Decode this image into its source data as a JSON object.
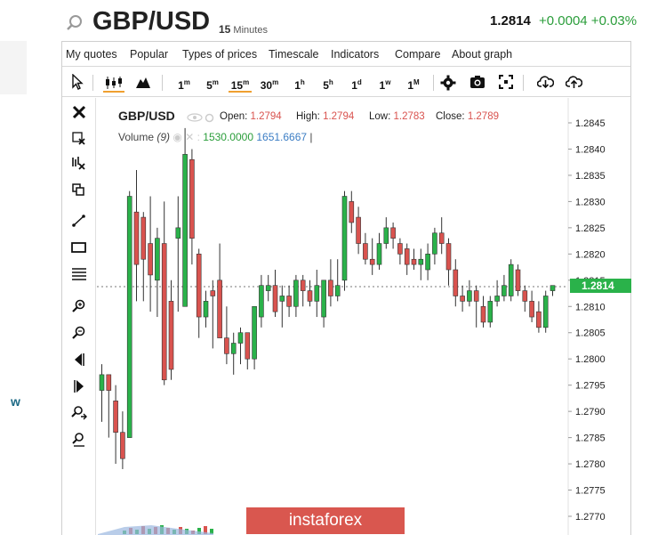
{
  "header": {
    "symbol": "GBP/USD",
    "interval_number": "15",
    "interval_unit": "Minutes",
    "price": "1.2814",
    "change": "+0.0004 +0.03%"
  },
  "menu": [
    "My quotes",
    "Popular",
    "Types of prices",
    "Timescale",
    "Indicators",
    "Compare",
    "About graph"
  ],
  "timeframes": [
    {
      "base": "1",
      "sup": "m",
      "active": false
    },
    {
      "base": "5",
      "sup": "m",
      "active": false
    },
    {
      "base": "15",
      "sup": "m",
      "active": true
    },
    {
      "base": "30",
      "sup": "m",
      "active": false
    },
    {
      "base": "1",
      "sup": "h",
      "active": false
    },
    {
      "base": "5",
      "sup": "h",
      "active": false
    },
    {
      "base": "1",
      "sup": "d",
      "active": false
    },
    {
      "base": "1",
      "sup": "w",
      "active": false
    },
    {
      "base": "1",
      "sup": "M",
      "active": false
    }
  ],
  "toolbar_icons": [
    "cursor-icon",
    "candlestick-icon",
    "area-chart-icon",
    "gear-icon",
    "camera-icon",
    "fullscreen-icon",
    "download-icon",
    "upload-icon"
  ],
  "left_tool_icons": [
    "close-icon",
    "remove-drawings-icon",
    "remove-indicators-icon",
    "copy-icon",
    "trendline-icon",
    "rectangle-icon",
    "fibonacci-icon",
    "zoom-in-icon",
    "zoom-out-icon",
    "scroll-left-icon",
    "scroll-right-icon",
    "zoom-reset-icon",
    "zoom-fit-icon"
  ],
  "legend": {
    "symbol": "GBP/USD",
    "open_label": "Open:",
    "open": "1.2794",
    "high_label": "High:",
    "high": "1.2794",
    "low_label": "Low:",
    "low": "1.2783",
    "close_label": "Close:",
    "close": "1.2789",
    "volume_label": "Volume",
    "volume_period": "(9)",
    "volume_value_1": "1530.0000",
    "volume_value_2": "1651.6667",
    "volume_cursor": "|"
  },
  "price_tag": "1.2814",
  "watermark": "instaforex",
  "side_logo": "w",
  "colors": {
    "up": "#2ab24a",
    "down": "#d9534f",
    "accent": "#f0a030",
    "change": "#2a9d3a"
  },
  "chart_data": {
    "type": "candlestick",
    "title": "GBP/USD",
    "ylim": [
      1.2768,
      1.2852
    ],
    "y_ticks": [
      "1.2845",
      "1.2840",
      "1.2835",
      "1.2830",
      "1.2825",
      "1.2820",
      "1.2815",
      "1.2810",
      "1.2805",
      "1.2800",
      "1.2795",
      "1.2790",
      "1.2785",
      "1.2780",
      "1.2775",
      "1.2770"
    ],
    "last_price": 1.2814,
    "candles": [
      {
        "o": 1.2794,
        "h": 1.2799,
        "l": 1.2788,
        "c": 1.2797
      },
      {
        "o": 1.2797,
        "h": 1.2797,
        "l": 1.2785,
        "c": 1.2794
      },
      {
        "o": 1.2792,
        "h": 1.2795,
        "l": 1.278,
        "c": 1.2786
      },
      {
        "o": 1.2786,
        "h": 1.279,
        "l": 1.2779,
        "c": 1.2781
      },
      {
        "o": 1.2785,
        "h": 1.2832,
        "l": 1.2785,
        "c": 1.2831
      },
      {
        "o": 1.2828,
        "h": 1.2836,
        "l": 1.2811,
        "c": 1.2818
      },
      {
        "o": 1.2827,
        "h": 1.2828,
        "l": 1.2811,
        "c": 1.2819
      },
      {
        "o": 1.2822,
        "h": 1.2831,
        "l": 1.2809,
        "c": 1.2816
      },
      {
        "o": 1.2815,
        "h": 1.2825,
        "l": 1.2808,
        "c": 1.2823
      },
      {
        "o": 1.2822,
        "h": 1.283,
        "l": 1.2795,
        "c": 1.2796
      },
      {
        "o": 1.2811,
        "h": 1.2815,
        "l": 1.2796,
        "c": 1.2798
      },
      {
        "o": 1.2823,
        "h": 1.2831,
        "l": 1.2809,
        "c": 1.2825
      },
      {
        "o": 1.281,
        "h": 1.2844,
        "l": 1.281,
        "c": 1.2839
      },
      {
        "o": 1.2838,
        "h": 1.284,
        "l": 1.2818,
        "c": 1.2823
      },
      {
        "o": 1.282,
        "h": 1.2821,
        "l": 1.2804,
        "c": 1.2808
      },
      {
        "o": 1.2808,
        "h": 1.2813,
        "l": 1.2806,
        "c": 1.2811
      },
      {
        "o": 1.2813,
        "h": 1.2815,
        "l": 1.2802,
        "c": 1.2812
      },
      {
        "o": 1.2815,
        "h": 1.2822,
        "l": 1.2805,
        "c": 1.2804
      },
      {
        "o": 1.2804,
        "h": 1.281,
        "l": 1.2799,
        "c": 1.2801
      },
      {
        "o": 1.2801,
        "h": 1.2805,
        "l": 1.2797,
        "c": 1.2803
      },
      {
        "o": 1.2803,
        "h": 1.2806,
        "l": 1.2799,
        "c": 1.2805
      },
      {
        "o": 1.2805,
        "h": 1.2805,
        "l": 1.2798,
        "c": 1.28
      },
      {
        "o": 1.28,
        "h": 1.281,
        "l": 1.2798,
        "c": 1.281
      },
      {
        "o": 1.2808,
        "h": 1.2816,
        "l": 1.2806,
        "c": 1.2814
      },
      {
        "o": 1.2813,
        "h": 1.2816,
        "l": 1.2811,
        "c": 1.2814
      },
      {
        "o": 1.2814,
        "h": 1.2817,
        "l": 1.2808,
        "c": 1.2809
      },
      {
        "o": 1.2811,
        "h": 1.2814,
        "l": 1.2806,
        "c": 1.2812
      },
      {
        "o": 1.2812,
        "h": 1.2814,
        "l": 1.2808,
        "c": 1.281
      },
      {
        "o": 1.281,
        "h": 1.2816,
        "l": 1.2808,
        "c": 1.2815
      },
      {
        "o": 1.2815,
        "h": 1.2816,
        "l": 1.281,
        "c": 1.2813
      },
      {
        "o": 1.2813,
        "h": 1.2815,
        "l": 1.281,
        "c": 1.2811
      },
      {
        "o": 1.2811,
        "h": 1.2817,
        "l": 1.2808,
        "c": 1.2814
      },
      {
        "o": 1.2808,
        "h": 1.2815,
        "l": 1.2806,
        "c": 1.2815
      },
      {
        "o": 1.2815,
        "h": 1.2819,
        "l": 1.281,
        "c": 1.2812
      },
      {
        "o": 1.2812,
        "h": 1.2819,
        "l": 1.2811,
        "c": 1.2814
      },
      {
        "o": 1.2815,
        "h": 1.2832,
        "l": 1.2813,
        "c": 1.2831
      },
      {
        "o": 1.283,
        "h": 1.2832,
        "l": 1.2824,
        "c": 1.2826
      },
      {
        "o": 1.2827,
        "h": 1.2829,
        "l": 1.282,
        "c": 1.2822
      },
      {
        "o": 1.2822,
        "h": 1.2824,
        "l": 1.2818,
        "c": 1.2819
      },
      {
        "o": 1.2819,
        "h": 1.2823,
        "l": 1.2816,
        "c": 1.2818
      },
      {
        "o": 1.2818,
        "h": 1.2824,
        "l": 1.2817,
        "c": 1.2822
      },
      {
        "o": 1.2822,
        "h": 1.2827,
        "l": 1.2821,
        "c": 1.2825
      },
      {
        "o": 1.2825,
        "h": 1.2826,
        "l": 1.2821,
        "c": 1.2823
      },
      {
        "o": 1.2822,
        "h": 1.2823,
        "l": 1.2818,
        "c": 1.282
      },
      {
        "o": 1.2821,
        "h": 1.2822,
        "l": 1.2816,
        "c": 1.2818
      },
      {
        "o": 1.2819,
        "h": 1.2821,
        "l": 1.2817,
        "c": 1.2818
      },
      {
        "o": 1.2818,
        "h": 1.2821,
        "l": 1.2815,
        "c": 1.2819
      },
      {
        "o": 1.2817,
        "h": 1.2822,
        "l": 1.2815,
        "c": 1.282
      },
      {
        "o": 1.282,
        "h": 1.2825,
        "l": 1.2818,
        "c": 1.2824
      },
      {
        "o": 1.2824,
        "h": 1.2827,
        "l": 1.282,
        "c": 1.2822
      },
      {
        "o": 1.2822,
        "h": 1.2823,
        "l": 1.2814,
        "c": 1.2817
      },
      {
        "o": 1.2817,
        "h": 1.2819,
        "l": 1.281,
        "c": 1.2812
      },
      {
        "o": 1.2812,
        "h": 1.2814,
        "l": 1.2809,
        "c": 1.2811
      },
      {
        "o": 1.2811,
        "h": 1.2815,
        "l": 1.281,
        "c": 1.2813
      },
      {
        "o": 1.2813,
        "h": 1.2814,
        "l": 1.2806,
        "c": 1.2811
      },
      {
        "o": 1.281,
        "h": 1.2812,
        "l": 1.2806,
        "c": 1.2807
      },
      {
        "o": 1.2807,
        "h": 1.2812,
        "l": 1.2806,
        "c": 1.2811
      },
      {
        "o": 1.2811,
        "h": 1.2815,
        "l": 1.281,
        "c": 1.2812
      },
      {
        "o": 1.2812,
        "h": 1.2816,
        "l": 1.2811,
        "c": 1.2814
      },
      {
        "o": 1.2812,
        "h": 1.2819,
        "l": 1.2811,
        "c": 1.2818
      },
      {
        "o": 1.2817,
        "h": 1.2818,
        "l": 1.2812,
        "c": 1.2813
      },
      {
        "o": 1.2813,
        "h": 1.2814,
        "l": 1.2809,
        "c": 1.2811
      },
      {
        "o": 1.2811,
        "h": 1.2813,
        "l": 1.2807,
        "c": 1.2808
      },
      {
        "o": 1.2809,
        "h": 1.2811,
        "l": 1.2805,
        "c": 1.2806
      },
      {
        "o": 1.2806,
        "h": 1.2813,
        "l": 1.2805,
        "c": 1.2812
      },
      {
        "o": 1.2813,
        "h": 1.2814,
        "l": 1.2812,
        "c": 1.2814
      }
    ]
  }
}
